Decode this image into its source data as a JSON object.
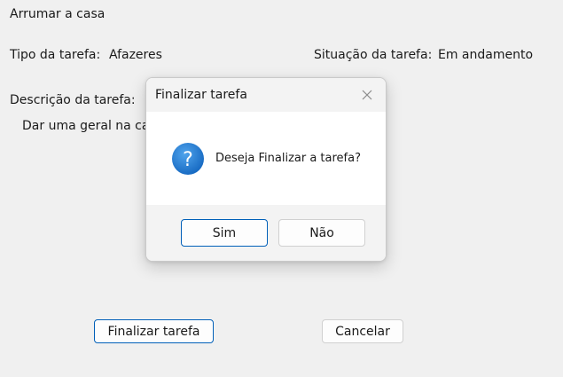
{
  "window": {
    "task_name": "Arrumar a casa"
  },
  "form": {
    "type_label": "Tipo da tarefa:",
    "type_value": "Afazeres",
    "status_label": "Situação da tarefa:",
    "status_value": "Em andamento",
    "description_label": "Descrição da tarefa:",
    "description_value": "Dar uma geral na casa"
  },
  "actions": {
    "finish_label": "Finalizar tarefa",
    "cancel_label": "Cancelar"
  },
  "dialog": {
    "title": "Finalizar tarefa",
    "message": "Deseja Finalizar a tarefa?",
    "yes_label": "Sim",
    "no_label": "Não",
    "icon": "question-icon",
    "close_icon": "close-icon"
  },
  "colors": {
    "accent": "#005fb8",
    "icon_blue": "#1a78d0",
    "background": "#f0f0f0"
  }
}
